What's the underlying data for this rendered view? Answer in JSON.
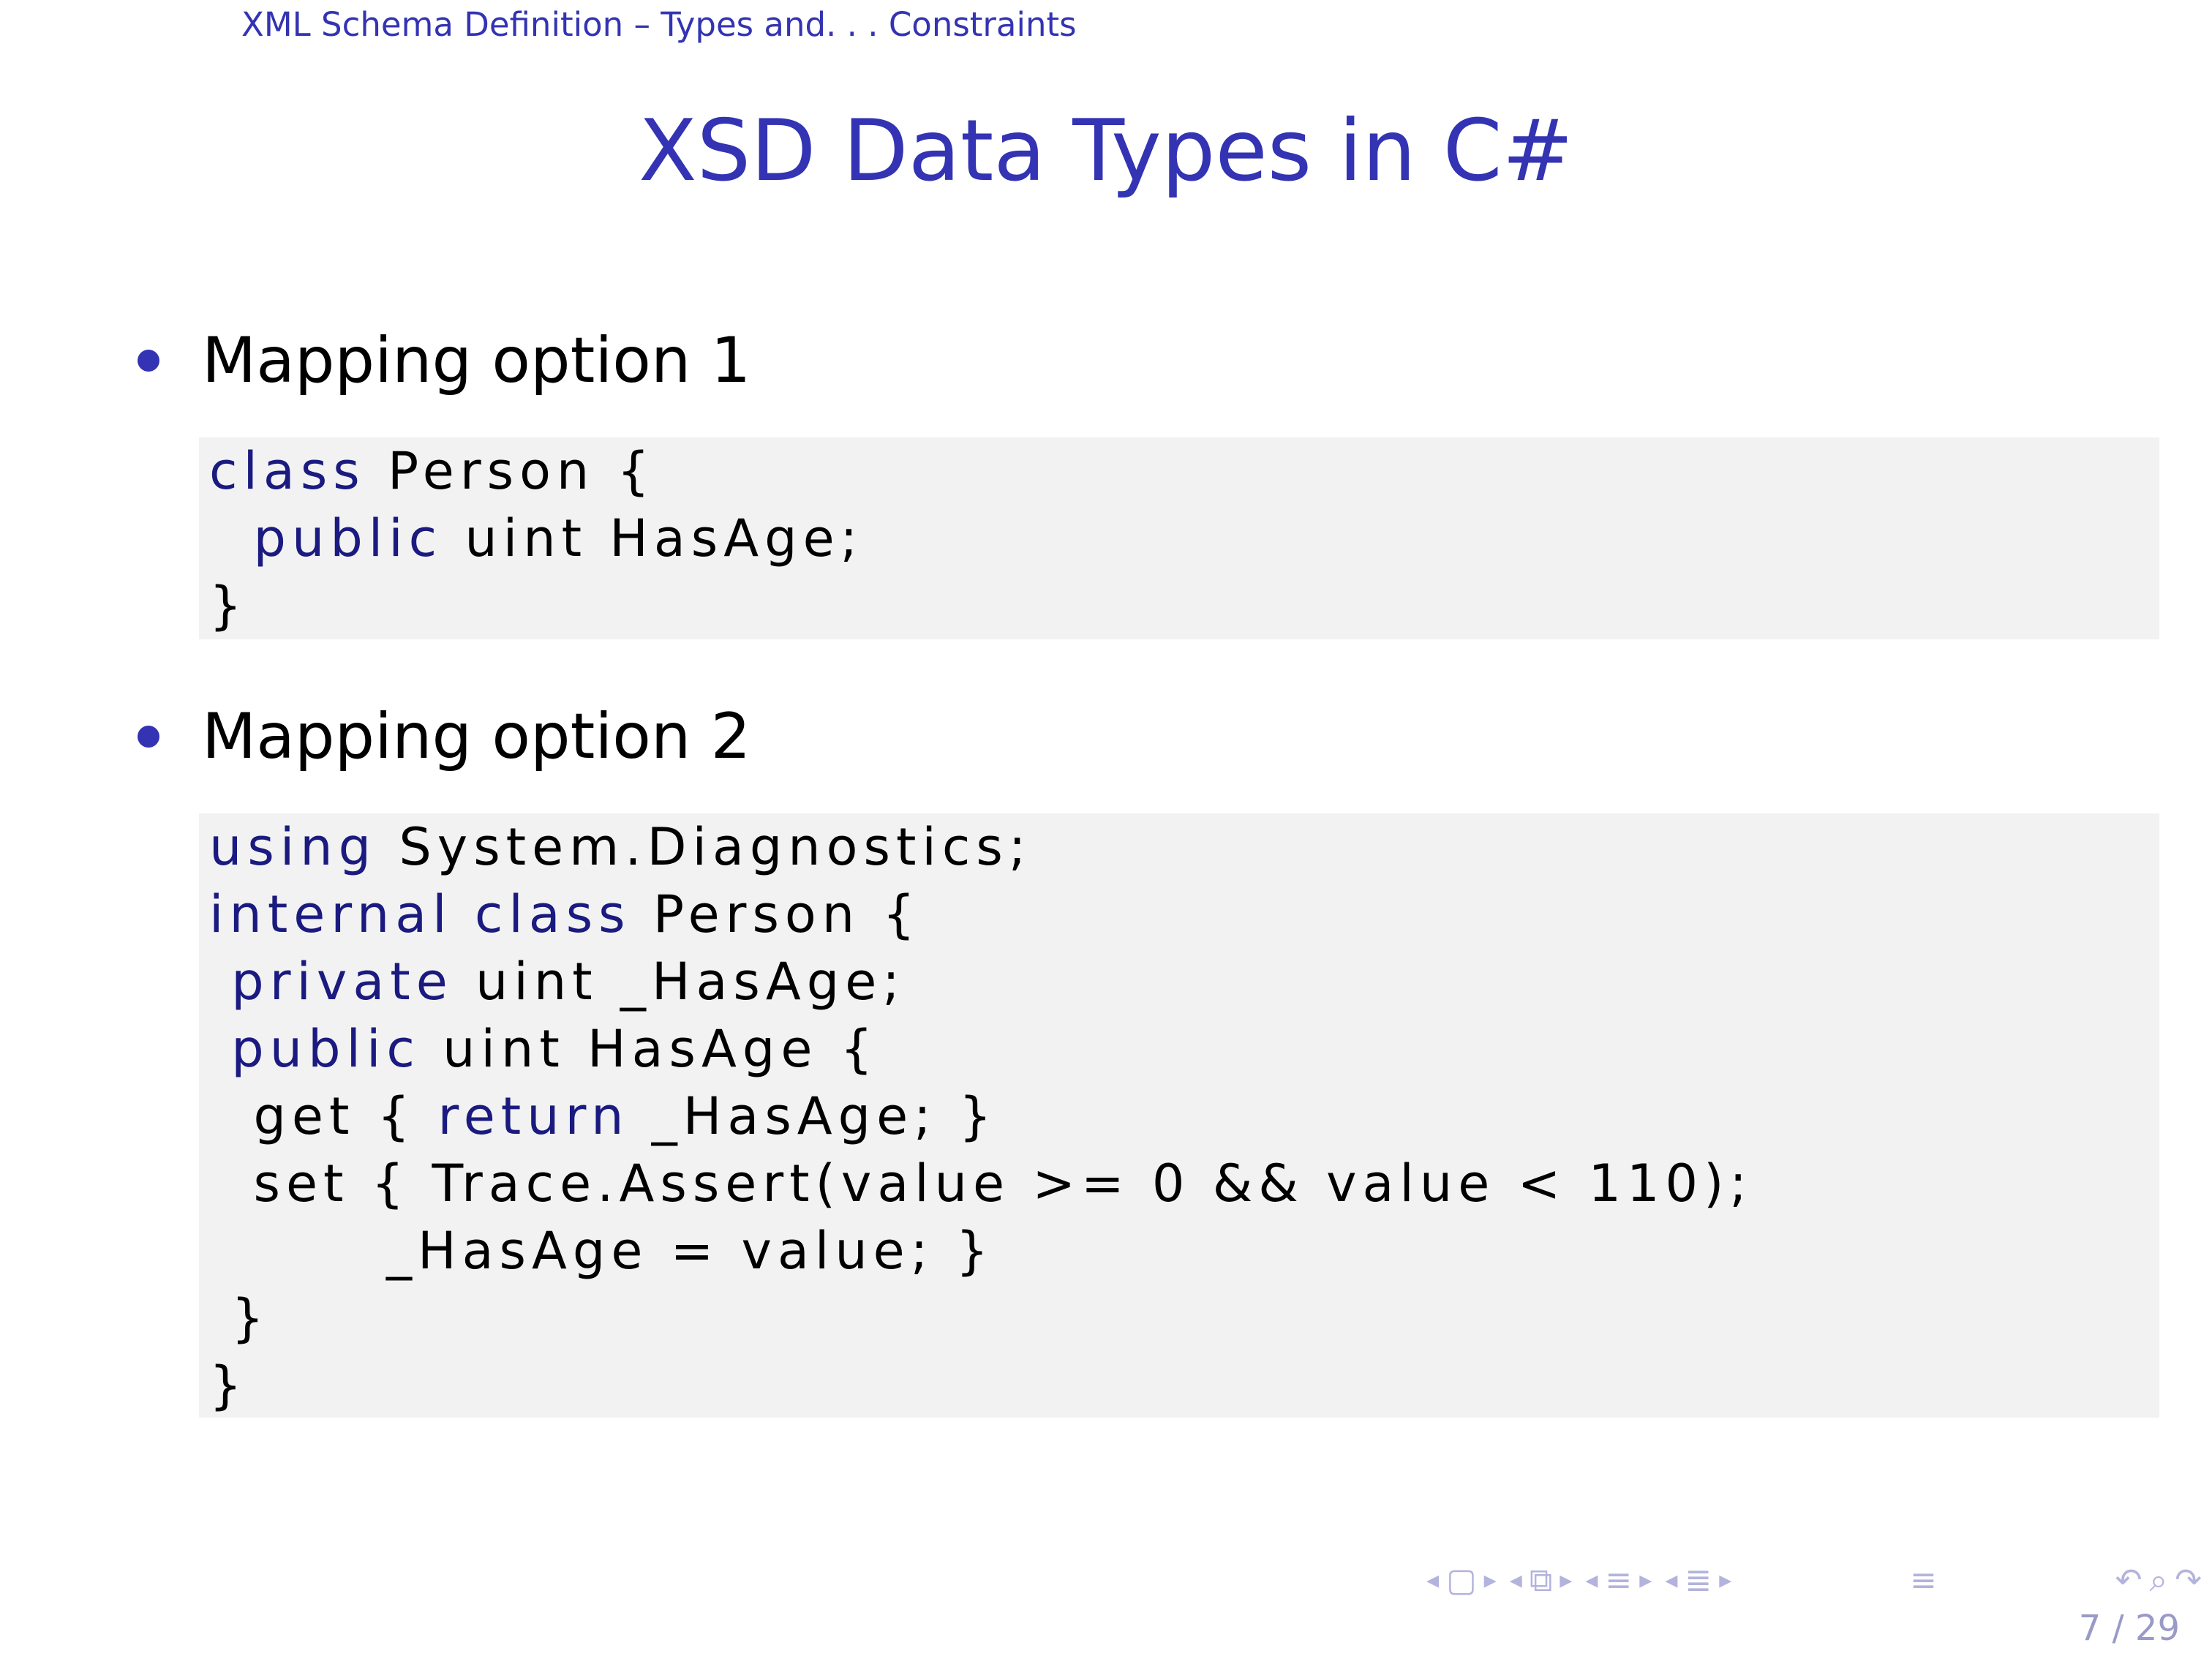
{
  "colors": {
    "accent": "#3333b3",
    "accent_dark": "#1a1a80",
    "code_background": "#f2f2f2",
    "navigation": "#b3b3dd"
  },
  "header": {
    "section": "XML Schema Definition – Types and. . . Constraints"
  },
  "frame": {
    "title": "XSD Data Types in C#"
  },
  "bullets": [
    {
      "label": "Mapping option 1"
    },
    {
      "label": "Mapping option 2"
    }
  ],
  "code_blocks": [
    {
      "lines": [
        [
          {
            "t": "class",
            "k": true
          },
          {
            "t": " Person {"
          }
        ],
        [
          {
            "t": "  "
          },
          {
            "t": "public",
            "k": true
          },
          {
            "t": " uint HasAge;"
          }
        ],
        [
          {
            "t": "}"
          }
        ]
      ]
    },
    {
      "lines": [
        [
          {
            "t": "using",
            "k": true
          },
          {
            "t": " System.Diagnostics;"
          }
        ],
        [
          {
            "t": "internal",
            "k": true
          },
          {
            "t": " "
          },
          {
            "t": "class",
            "k": true
          },
          {
            "t": " Person {"
          }
        ],
        [
          {
            "t": " "
          },
          {
            "t": "private",
            "k": true
          },
          {
            "t": " uint _HasAge;"
          }
        ],
        [
          {
            "t": " "
          },
          {
            "t": "public",
            "k": true
          },
          {
            "t": " uint HasAge {"
          }
        ],
        [
          {
            "t": "  get { "
          },
          {
            "t": "return",
            "k": true
          },
          {
            "t": " _HasAge; }"
          }
        ],
        [
          {
            "t": "  set { Trace.Assert(value >= 0 && value < 110);"
          }
        ],
        [
          {
            "t": "        _HasAge = value; }"
          }
        ],
        [
          {
            "t": " }"
          }
        ],
        [
          {
            "t": "}"
          }
        ]
      ]
    }
  ],
  "navigation": {
    "icons": [
      "arrow-left-icon",
      "frame-icon",
      "arrow-right-icon",
      "arrow-left-icon",
      "subsection-icon",
      "arrow-right-icon",
      "arrow-left-icon",
      "section-icon",
      "arrow-right-icon",
      "arrow-left-icon",
      "doc-icon",
      "arrow-right-icon",
      "align-icon",
      "back-icon",
      "search-icon",
      "forward-icon"
    ],
    "page": "7 / 29"
  }
}
